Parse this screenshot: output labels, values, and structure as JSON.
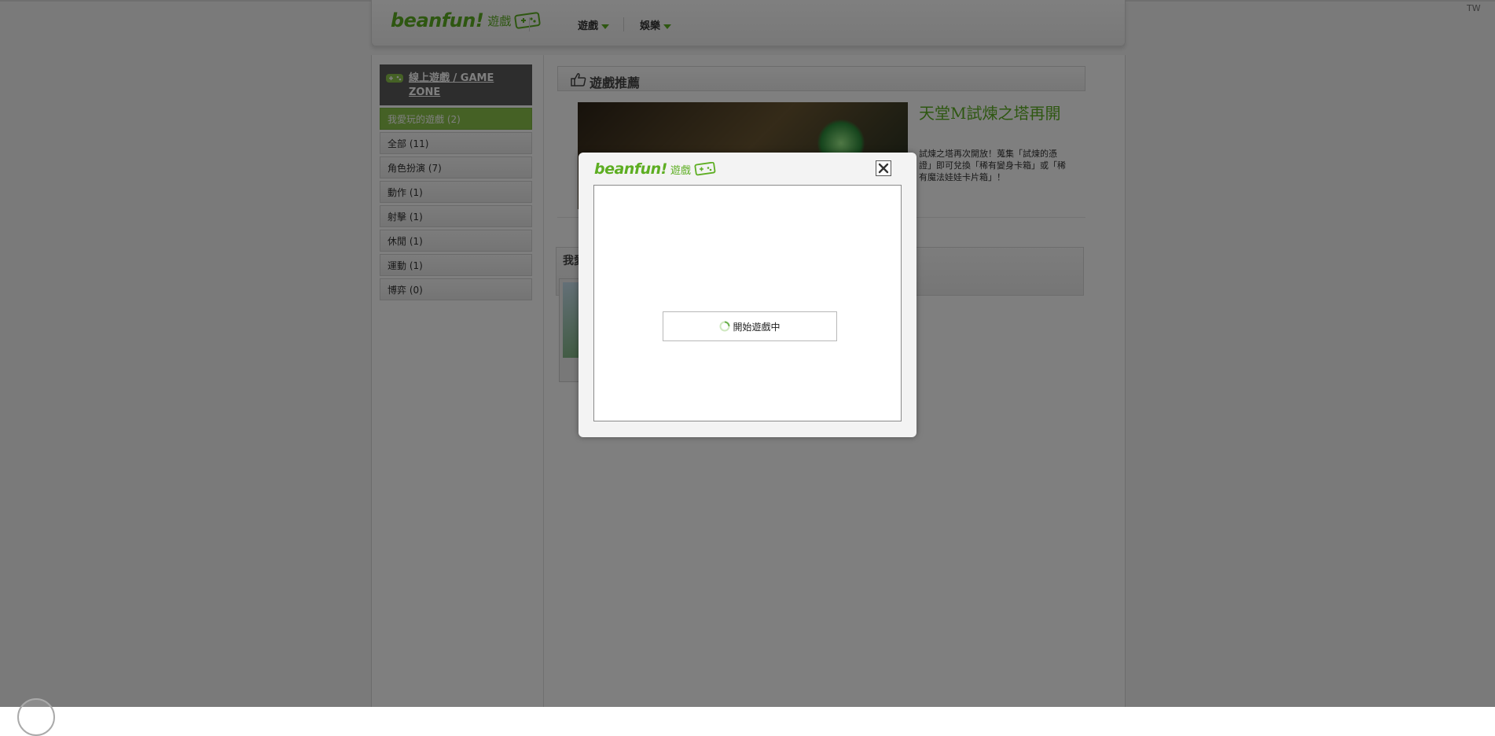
{
  "header": {
    "logo_word": "beanfun!",
    "logo_game": "遊戲",
    "nav": [
      {
        "label": "遊戲"
      },
      {
        "label": "娛樂"
      }
    ],
    "region": "TW"
  },
  "sidebar": {
    "title": "線上遊戲 / GAME ZONE",
    "categories": [
      {
        "label": "我愛玩的遊戲 (2)",
        "active": true
      },
      {
        "label": "全部 (11)"
      },
      {
        "label": "角色扮演 (7)"
      },
      {
        "label": "動作 (1)"
      },
      {
        "label": "射擊 (1)"
      },
      {
        "label": "休閒 (1)"
      },
      {
        "label": "運動 (1)"
      },
      {
        "label": "博弈 (0)"
      }
    ]
  },
  "recommend": {
    "title": "遊戲推薦",
    "banner_title": "天堂M 試煉之塔再開",
    "headline": "天堂M試煉之塔再開",
    "description": "試煉之塔再次開放！蒐集「試煉的憑證」即可兌換「稀有變身卡箱」或「稀有魔法娃娃卡片箱」！"
  },
  "my_games": {
    "title": "我愛"
  },
  "modal": {
    "logo_word": "beanfun!",
    "logo_game": "遊戲",
    "loading_text": "開始遊戲中"
  },
  "colors": {
    "brand_green": "#5dae22",
    "active_category": "#8bc34a",
    "overlay": "rgba(0,0,0,0.5)"
  }
}
